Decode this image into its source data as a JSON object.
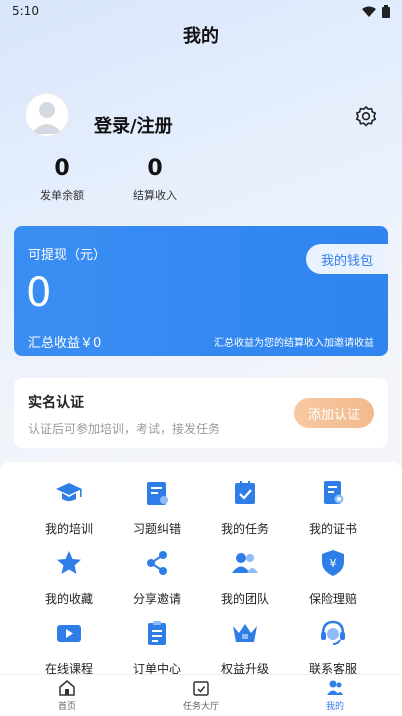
{
  "status_bar": {
    "time": "5:10"
  },
  "header": {
    "title": "我的"
  },
  "profile": {
    "login_label": "登录/注册"
  },
  "stats": [
    {
      "value": "0",
      "label": "发单余额"
    },
    {
      "value": "0",
      "label": "结算收入"
    }
  ],
  "wallet": {
    "withdraw_label": "可提现（元）",
    "amount": "0",
    "wallet_button": "我的钱包",
    "total_label": "汇总收益￥0",
    "note": "汇总收益为您的结算收入加邀请收益"
  },
  "verify": {
    "title": "实名认证",
    "description": "认证后可参加培训，考试，接发任务",
    "button": "添加认证"
  },
  "grid": [
    {
      "label": "我的培训",
      "icon": "graduation-cap-icon"
    },
    {
      "label": "习题纠错",
      "icon": "exercise-icon"
    },
    {
      "label": "我的任务",
      "icon": "task-icon"
    },
    {
      "label": "我的证书",
      "icon": "certificate-icon"
    },
    {
      "label": "我的收藏",
      "icon": "star-icon"
    },
    {
      "label": "分享邀请",
      "icon": "share-icon"
    },
    {
      "label": "我的团队",
      "icon": "team-icon"
    },
    {
      "label": "保险理赔",
      "icon": "insurance-icon"
    },
    {
      "label": "在线课程",
      "icon": "video-icon"
    },
    {
      "label": "订单中心",
      "icon": "order-icon"
    },
    {
      "label": "权益升级",
      "icon": "crown-icon"
    },
    {
      "label": "联系客服",
      "icon": "service-icon"
    }
  ],
  "tabbar": [
    {
      "label": "首页",
      "icon": "home-icon"
    },
    {
      "label": "任务大厅",
      "icon": "task-hall-icon"
    },
    {
      "label": "我的",
      "icon": "profile-icon",
      "active": true
    }
  ],
  "colors": {
    "accent": "#2f7de6",
    "orange": "#f3b98b"
  }
}
